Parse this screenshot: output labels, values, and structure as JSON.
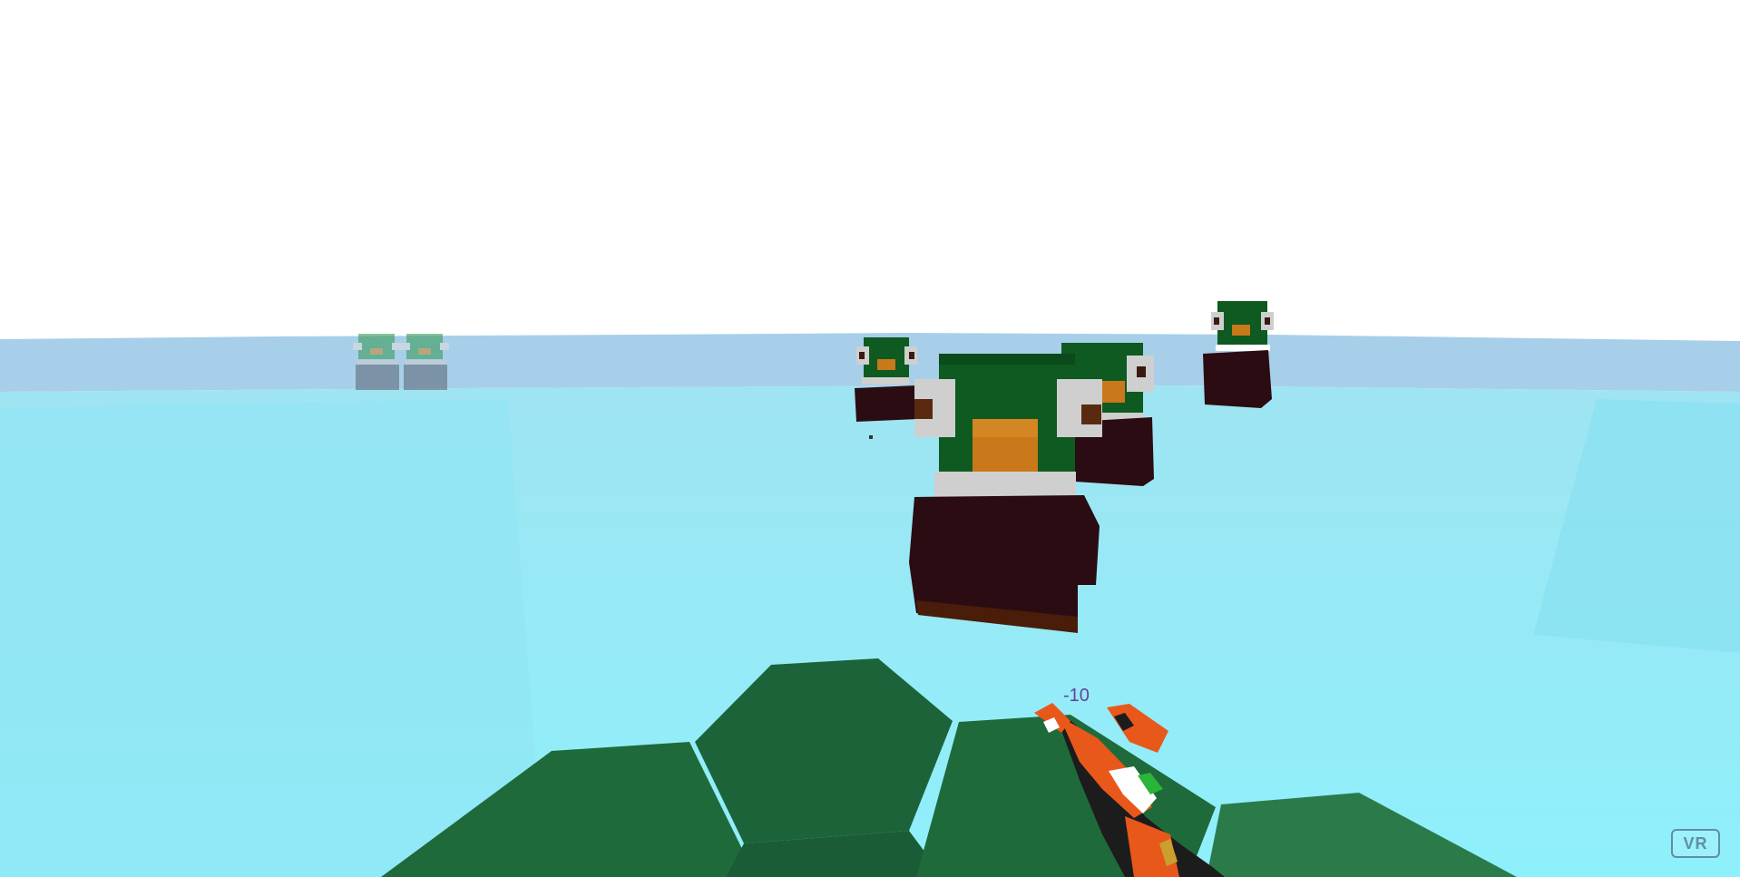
{
  "hud": {
    "score_popup": "-10",
    "vr_button_label": "VR"
  },
  "colors": {
    "sky": "#ffffff",
    "horizon_band": "#a7cfe9",
    "water": "#8eeaf8",
    "lilypad": "#1f6a3b",
    "duck_head": "#0e5a20",
    "duck_body": "#2a0c12",
    "duck_bill": "#c9781a",
    "gun_orange": "#e8581a",
    "gun_black": "#1c1c1c",
    "score_text": "#6a3fa0"
  },
  "scene": {
    "targets": [
      "duck",
      "duck",
      "duck",
      "duck",
      "duck",
      "duck"
    ],
    "weapon": "orange-blaster",
    "terrain": [
      "lilypad",
      "lilypad",
      "lilypad",
      "lilypad"
    ]
  }
}
